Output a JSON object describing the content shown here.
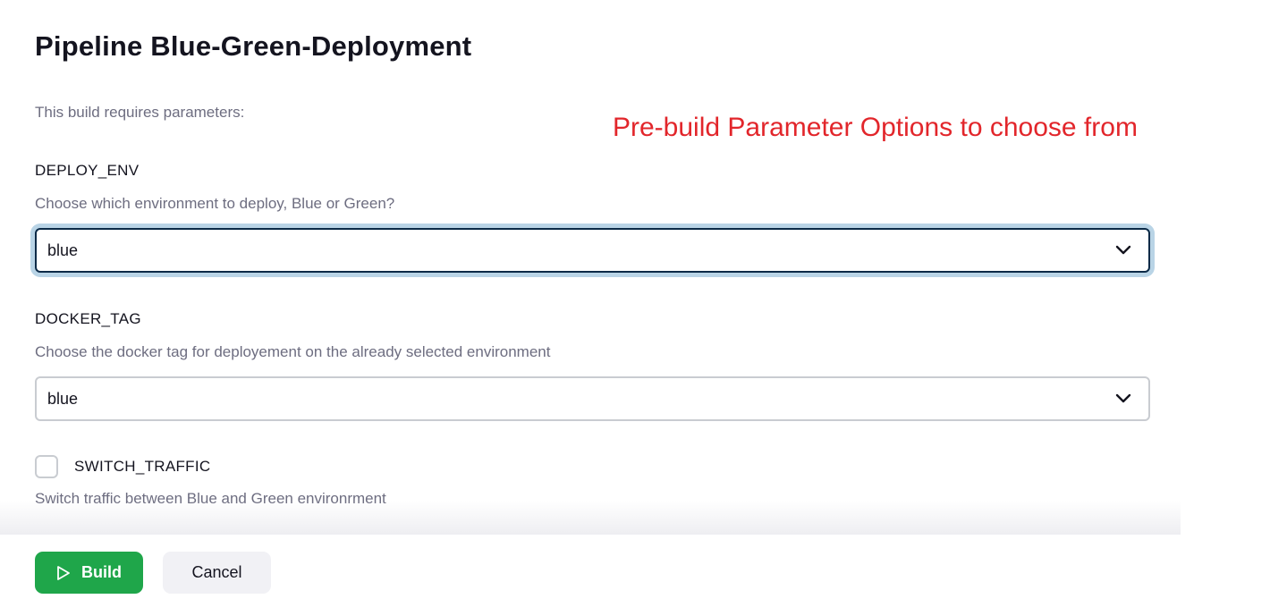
{
  "page": {
    "title": "Pipeline Blue-Green-Deployment",
    "subtitle": "This build requires parameters:",
    "annotation": "Pre-build Parameter Options to choose from"
  },
  "parameters": {
    "deploy_env": {
      "name": "DEPLOY_ENV",
      "description": "Choose which environment to deploy, Blue or Green?",
      "value": "blue"
    },
    "docker_tag": {
      "name": "DOCKER_TAG",
      "description": "Choose the docker tag for deployement on the already selected environment",
      "value": "blue"
    },
    "switch_traffic": {
      "name": "SWITCH_TRAFFIC",
      "description": "Switch traffic between Blue and Green environrment",
      "checked": false
    }
  },
  "footer": {
    "build_label": "Build",
    "cancel_label": "Cancel"
  },
  "colors": {
    "accent_green": "#1fa64a",
    "annotation_red": "#e2262b",
    "focus_ring": "#b9d4e6"
  },
  "icons": {
    "select_chevron": "chevron-down-icon",
    "build": "play-icon"
  }
}
